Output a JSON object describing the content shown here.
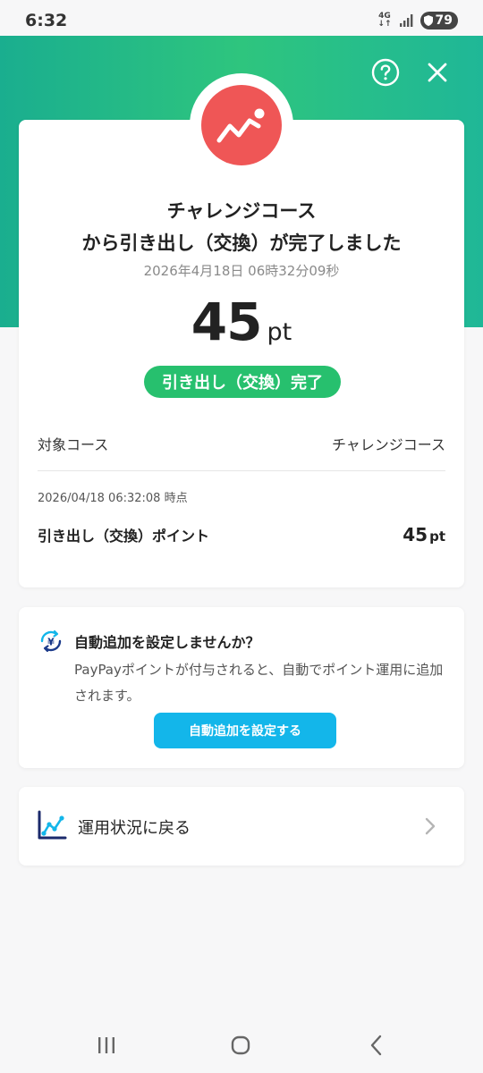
{
  "status_bar": {
    "time": "6:32",
    "network": "4G",
    "battery": "79"
  },
  "header": {
    "help_icon": "question-circle-icon",
    "close_icon": "close-icon"
  },
  "result": {
    "logo_icon": "trending-up-icon",
    "title_line1": "チャレンジコース",
    "title_line2": "から引き出し（交換）が完了しました",
    "timestamp": "2026年4月18日 06時32分09秒",
    "points_value": "45",
    "points_unit": "pt",
    "status_badge": "引き出し（交換）完了"
  },
  "details": {
    "course_label": "対象コース",
    "course_value": "チャレンジコース",
    "as_of": "2026/04/18 06:32:08 時点",
    "withdraw_label": "引き出し（交換）ポイント",
    "withdraw_value": "45",
    "withdraw_unit": "pt"
  },
  "promo": {
    "title": "自動追加を設定しませんか？",
    "description": "PayPayポイントが付与されると、自動でポイント運用に追加されます。",
    "button_label": "自動追加を設定する"
  },
  "back_link": {
    "label": "運用状況に戻る"
  },
  "colors": {
    "header_green": "#1fb797",
    "badge_green": "#27c06e",
    "logo_red": "#ef5656",
    "button_blue": "#13b6ea"
  }
}
